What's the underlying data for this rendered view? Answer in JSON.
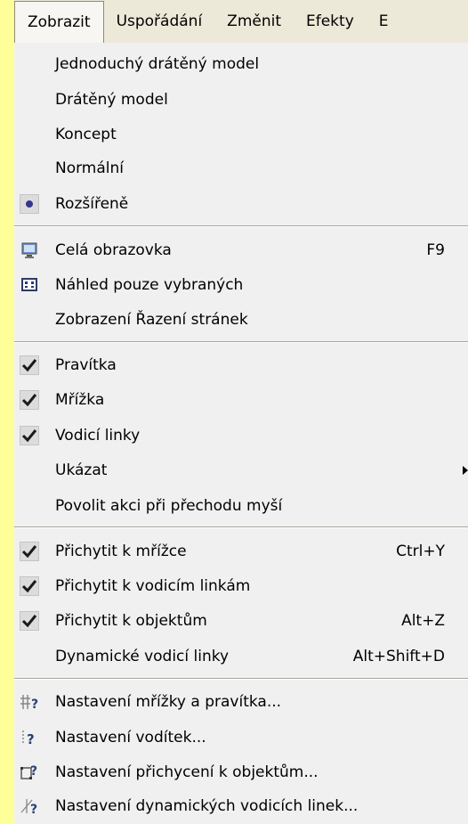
{
  "menubar": {
    "items": [
      "Zobrazit",
      "Uspořádání",
      "Změnit",
      "Efekty",
      "E"
    ]
  },
  "menu": {
    "view_modes": [
      {
        "label": "Jednoduchý drátěný model",
        "shortcut": ""
      },
      {
        "label": "Drátěný model",
        "shortcut": ""
      },
      {
        "label": "Koncept",
        "shortcut": ""
      },
      {
        "label": "Normální",
        "shortcut": ""
      },
      {
        "label": "Rozšířeně",
        "shortcut": "",
        "selected": true
      }
    ],
    "screen": [
      {
        "label": "Celá obrazovka",
        "shortcut": "F9",
        "icon": "monitor-icon"
      },
      {
        "label": "Náhled pouze vybraných",
        "shortcut": "",
        "icon": "preview-selected-icon"
      },
      {
        "label": "Zobrazení Řazení stránek",
        "shortcut": ""
      }
    ],
    "toggles": [
      {
        "label": "Pravítka",
        "checked": true
      },
      {
        "label": "Mřížka",
        "checked": true
      },
      {
        "label": "Vodicí linky",
        "checked": true
      },
      {
        "label": "Ukázat",
        "submenu": true
      },
      {
        "label": "Povolit akci při přechodu myší"
      }
    ],
    "snap": [
      {
        "label": "Přichytit k mřížce",
        "shortcut": "Ctrl+Y",
        "checked": true
      },
      {
        "label": "Přichytit k vodicím linkám",
        "shortcut": "",
        "checked": true
      },
      {
        "label": "Přichytit k objektům",
        "shortcut": "Alt+Z",
        "checked": true
      },
      {
        "label": "Dynamické vodicí linky",
        "shortcut": "Alt+Shift+D"
      }
    ],
    "settings": [
      {
        "label": "Nastavení mřížky a pravítka...",
        "icon": "grid-settings-icon"
      },
      {
        "label": "Nastavení vodítek...",
        "icon": "guides-settings-icon"
      },
      {
        "label": "Nastavení přichycení k objektům...",
        "icon": "snap-settings-icon"
      },
      {
        "label": "Nastavení dynamických vodicích linek...",
        "icon": "dynamic-guides-settings-icon"
      }
    ]
  },
  "colors": {
    "accent": "#ffff99",
    "menubar": "#ece9d8",
    "menu": "#f0f0f0",
    "check": "#1a1a1a"
  }
}
